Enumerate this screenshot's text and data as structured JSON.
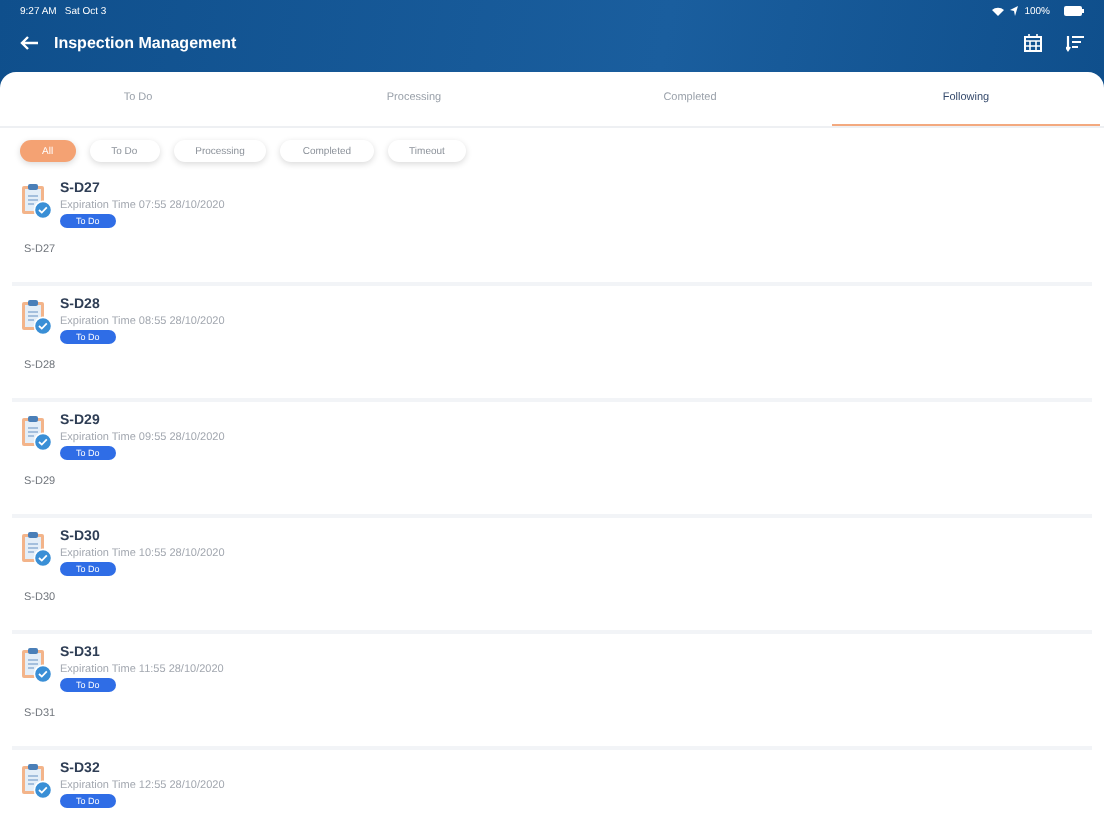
{
  "status_bar": {
    "time": "9:27 AM",
    "date": "Sat Oct 3",
    "battery": "100%"
  },
  "header": {
    "title": "Inspection Management"
  },
  "tabs": [
    {
      "label": "To Do",
      "selected": false
    },
    {
      "label": "Processing",
      "selected": false
    },
    {
      "label": "Completed",
      "selected": false
    },
    {
      "label": "Following",
      "selected": true
    }
  ],
  "filters": [
    {
      "label": "All",
      "selected": true
    },
    {
      "label": "To Do",
      "selected": false
    },
    {
      "label": "Processing",
      "selected": false
    },
    {
      "label": "Completed",
      "selected": false
    },
    {
      "label": "Timeout",
      "selected": false
    }
  ],
  "items": [
    {
      "title": "S-D27",
      "expiration": "Expiration Time 07:55 28/10/2020",
      "status": "To Do",
      "footer": "S-D27"
    },
    {
      "title": "S-D28",
      "expiration": "Expiration Time 08:55 28/10/2020",
      "status": "To Do",
      "footer": "S-D28"
    },
    {
      "title": "S-D29",
      "expiration": "Expiration Time 09:55 28/10/2020",
      "status": "To Do",
      "footer": "S-D29"
    },
    {
      "title": "S-D30",
      "expiration": "Expiration Time 10:55 28/10/2020",
      "status": "To Do",
      "footer": "S-D30"
    },
    {
      "title": "S-D31",
      "expiration": "Expiration Time 11:55 28/10/2020",
      "status": "To Do",
      "footer": "S-D31"
    },
    {
      "title": "S-D32",
      "expiration": "Expiration Time 12:55 28/10/2020",
      "status": "To Do"
    }
  ]
}
